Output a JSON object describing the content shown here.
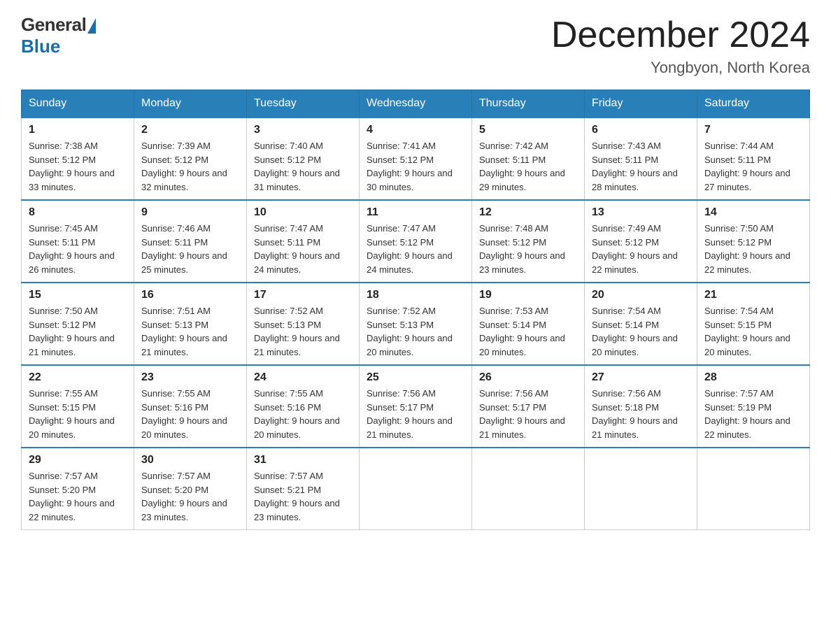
{
  "logo": {
    "general": "General",
    "blue": "Blue"
  },
  "title": {
    "month_year": "December 2024",
    "location": "Yongbyon, North Korea"
  },
  "weekdays": [
    "Sunday",
    "Monday",
    "Tuesday",
    "Wednesday",
    "Thursday",
    "Friday",
    "Saturday"
  ],
  "weeks": [
    [
      {
        "day": "1",
        "sunrise": "7:38 AM",
        "sunset": "5:12 PM",
        "daylight": "9 hours and 33 minutes."
      },
      {
        "day": "2",
        "sunrise": "7:39 AM",
        "sunset": "5:12 PM",
        "daylight": "9 hours and 32 minutes."
      },
      {
        "day": "3",
        "sunrise": "7:40 AM",
        "sunset": "5:12 PM",
        "daylight": "9 hours and 31 minutes."
      },
      {
        "day": "4",
        "sunrise": "7:41 AM",
        "sunset": "5:12 PM",
        "daylight": "9 hours and 30 minutes."
      },
      {
        "day": "5",
        "sunrise": "7:42 AM",
        "sunset": "5:11 PM",
        "daylight": "9 hours and 29 minutes."
      },
      {
        "day": "6",
        "sunrise": "7:43 AM",
        "sunset": "5:11 PM",
        "daylight": "9 hours and 28 minutes."
      },
      {
        "day": "7",
        "sunrise": "7:44 AM",
        "sunset": "5:11 PM",
        "daylight": "9 hours and 27 minutes."
      }
    ],
    [
      {
        "day": "8",
        "sunrise": "7:45 AM",
        "sunset": "5:11 PM",
        "daylight": "9 hours and 26 minutes."
      },
      {
        "day": "9",
        "sunrise": "7:46 AM",
        "sunset": "5:11 PM",
        "daylight": "9 hours and 25 minutes."
      },
      {
        "day": "10",
        "sunrise": "7:47 AM",
        "sunset": "5:11 PM",
        "daylight": "9 hours and 24 minutes."
      },
      {
        "day": "11",
        "sunrise": "7:47 AM",
        "sunset": "5:12 PM",
        "daylight": "9 hours and 24 minutes."
      },
      {
        "day": "12",
        "sunrise": "7:48 AM",
        "sunset": "5:12 PM",
        "daylight": "9 hours and 23 minutes."
      },
      {
        "day": "13",
        "sunrise": "7:49 AM",
        "sunset": "5:12 PM",
        "daylight": "9 hours and 22 minutes."
      },
      {
        "day": "14",
        "sunrise": "7:50 AM",
        "sunset": "5:12 PM",
        "daylight": "9 hours and 22 minutes."
      }
    ],
    [
      {
        "day": "15",
        "sunrise": "7:50 AM",
        "sunset": "5:12 PM",
        "daylight": "9 hours and 21 minutes."
      },
      {
        "day": "16",
        "sunrise": "7:51 AM",
        "sunset": "5:13 PM",
        "daylight": "9 hours and 21 minutes."
      },
      {
        "day": "17",
        "sunrise": "7:52 AM",
        "sunset": "5:13 PM",
        "daylight": "9 hours and 21 minutes."
      },
      {
        "day": "18",
        "sunrise": "7:52 AM",
        "sunset": "5:13 PM",
        "daylight": "9 hours and 20 minutes."
      },
      {
        "day": "19",
        "sunrise": "7:53 AM",
        "sunset": "5:14 PM",
        "daylight": "9 hours and 20 minutes."
      },
      {
        "day": "20",
        "sunrise": "7:54 AM",
        "sunset": "5:14 PM",
        "daylight": "9 hours and 20 minutes."
      },
      {
        "day": "21",
        "sunrise": "7:54 AM",
        "sunset": "5:15 PM",
        "daylight": "9 hours and 20 minutes."
      }
    ],
    [
      {
        "day": "22",
        "sunrise": "7:55 AM",
        "sunset": "5:15 PM",
        "daylight": "9 hours and 20 minutes."
      },
      {
        "day": "23",
        "sunrise": "7:55 AM",
        "sunset": "5:16 PM",
        "daylight": "9 hours and 20 minutes."
      },
      {
        "day": "24",
        "sunrise": "7:55 AM",
        "sunset": "5:16 PM",
        "daylight": "9 hours and 20 minutes."
      },
      {
        "day": "25",
        "sunrise": "7:56 AM",
        "sunset": "5:17 PM",
        "daylight": "9 hours and 21 minutes."
      },
      {
        "day": "26",
        "sunrise": "7:56 AM",
        "sunset": "5:17 PM",
        "daylight": "9 hours and 21 minutes."
      },
      {
        "day": "27",
        "sunrise": "7:56 AM",
        "sunset": "5:18 PM",
        "daylight": "9 hours and 21 minutes."
      },
      {
        "day": "28",
        "sunrise": "7:57 AM",
        "sunset": "5:19 PM",
        "daylight": "9 hours and 22 minutes."
      }
    ],
    [
      {
        "day": "29",
        "sunrise": "7:57 AM",
        "sunset": "5:20 PM",
        "daylight": "9 hours and 22 minutes."
      },
      {
        "day": "30",
        "sunrise": "7:57 AM",
        "sunset": "5:20 PM",
        "daylight": "9 hours and 23 minutes."
      },
      {
        "day": "31",
        "sunrise": "7:57 AM",
        "sunset": "5:21 PM",
        "daylight": "9 hours and 23 minutes."
      },
      null,
      null,
      null,
      null
    ]
  ]
}
